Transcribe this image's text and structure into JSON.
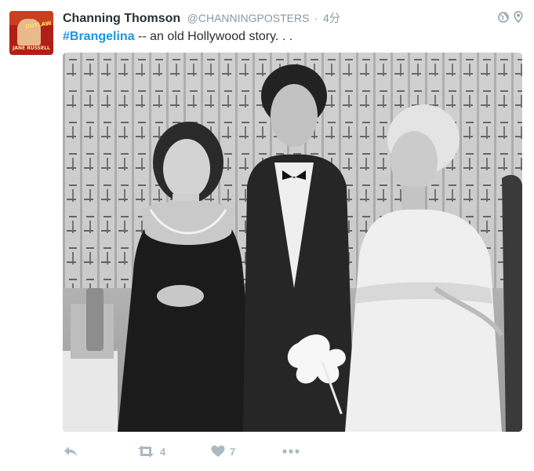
{
  "tweet": {
    "author": {
      "fullname": "Channing Thomson",
      "username": "@CHANNINGPOSTERS",
      "avatar_poster_title": "OUTLAW",
      "avatar_poster_name": "JANE RUSSELL"
    },
    "separator": "·",
    "timestamp": "4分",
    "hashtag": "#Brangelina",
    "text": " -- an old Hollywood story. . .",
    "header_icons": [
      "globe-icon",
      "location-pin-icon"
    ],
    "media": {
      "description_icon": "photo"
    },
    "actions": {
      "reply_icon": "reply-icon",
      "retweet_icon": "retweet-icon",
      "retweet_count": "4",
      "like_icon": "heart-icon",
      "like_count": "7",
      "more_icon": "more-icon"
    }
  },
  "colors": {
    "link": "#1b95e0",
    "secondary_text": "#8899a6",
    "action_icon": "#aab8c2",
    "primary_text": "#292f33"
  }
}
